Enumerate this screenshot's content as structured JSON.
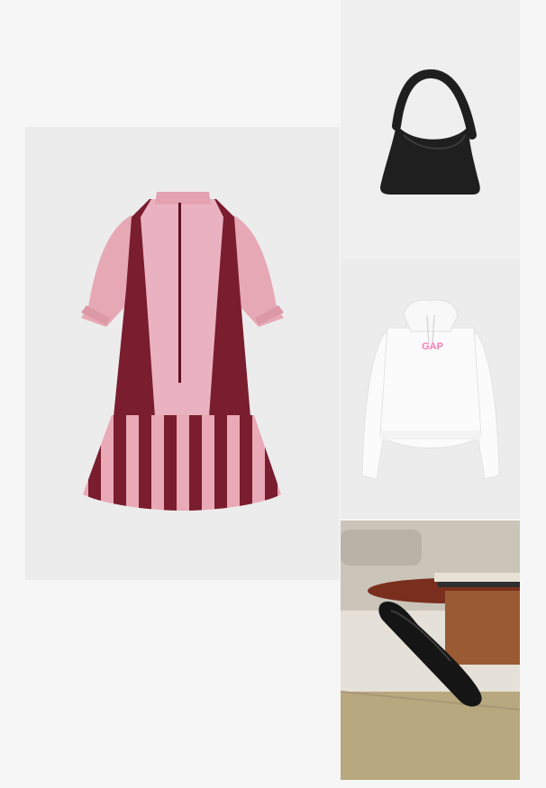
{
  "outfit": {
    "items": [
      {
        "id": "dress",
        "icon": "striped-shirt-dress-icon"
      },
      {
        "id": "bag",
        "icon": "black-shoulder-bag-icon"
      },
      {
        "id": "hoodie",
        "icon": "white-hoodie-icon",
        "print_text": "GAP"
      },
      {
        "id": "shoe",
        "icon": "black-ballet-flat-icon"
      }
    ]
  },
  "colors": {
    "dress_pink": "#e9a9b7",
    "dress_wine": "#7a1d2e",
    "bag_black": "#1f1f1f",
    "hoodie_white": "#fbfbfb",
    "gap_pink": "#f47cb6",
    "floor_beige": "#b8a880"
  }
}
